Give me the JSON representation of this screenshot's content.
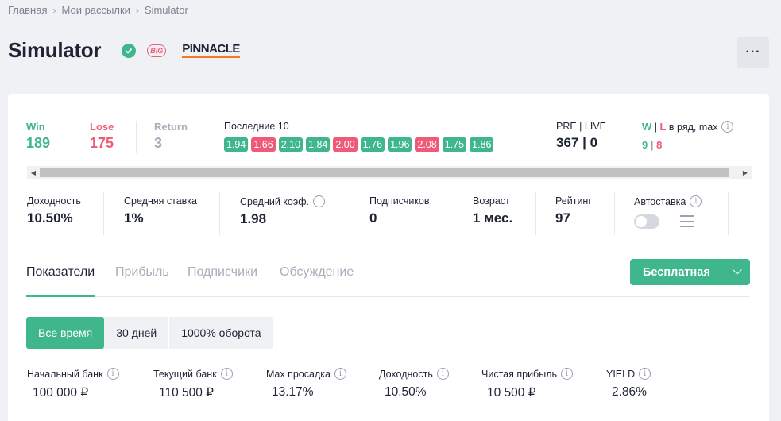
{
  "breadcrumb": {
    "items": [
      "Главная",
      "Мои рассылки",
      "Simulator"
    ]
  },
  "header": {
    "title": "Simulator",
    "badge_big": "BIG",
    "bookmaker": "PINNACLE",
    "more_label": "···"
  },
  "stats": {
    "win": {
      "label": "Win",
      "value": "189",
      "color": "#3fb68b"
    },
    "lose": {
      "label": "Lose",
      "value": "175",
      "color": "#ee5a78"
    },
    "return": {
      "label": "Return",
      "value": "3",
      "color": "#a9aeba"
    },
    "last10": {
      "label": "Последние 10",
      "chips": [
        {
          "value": "1.94",
          "result": "win"
        },
        {
          "value": "1.66",
          "result": "lose"
        },
        {
          "value": "2.10",
          "result": "win"
        },
        {
          "value": "1.84",
          "result": "win"
        },
        {
          "value": "2.00",
          "result": "lose"
        },
        {
          "value": "1.76",
          "result": "win"
        },
        {
          "value": "1.96",
          "result": "win"
        },
        {
          "value": "2.08",
          "result": "lose"
        },
        {
          "value": "1.75",
          "result": "win"
        },
        {
          "value": "1.86",
          "result": "win"
        }
      ]
    },
    "prelive": {
      "label": "PRE | LIVE",
      "value": "367 | 0"
    },
    "streak": {
      "label_w": "W",
      "label_sep": " | ",
      "label_l": "L",
      "label_rest": " в ряд, max",
      "value_w": "9",
      "value_sep": " | ",
      "value_l": "8"
    }
  },
  "metrics": {
    "yield": {
      "label": "Доходность",
      "value": "10.50%"
    },
    "avg_stake": {
      "label": "Средняя ставка",
      "value": "1%"
    },
    "avg_odds": {
      "label": "Средний коэф.",
      "value": "1.98"
    },
    "subscribers": {
      "label": "Подписчиков",
      "value": "0"
    },
    "age": {
      "label": "Возраст",
      "value": "1 мес."
    },
    "rating": {
      "label": "Рейтинг",
      "value": "97"
    },
    "autobet": {
      "label": "Автоставка"
    }
  },
  "tabs": [
    "Показатели",
    "Прибыль",
    "Подписчики",
    "Обсуждение"
  ],
  "plan_button": "Бесплатная",
  "periods": [
    "Все время",
    "30 дней",
    "1000% оборота"
  ],
  "bank": {
    "start": {
      "label": "Начальный банк",
      "value": "100 000 ₽"
    },
    "current": {
      "label": "Текущий банк",
      "value": "110 500 ₽"
    },
    "drawdown": {
      "label": "Max просадка",
      "value": "13.17%"
    },
    "yield": {
      "label": "Доходность",
      "value": "10.50%"
    },
    "profit": {
      "label": "Чистая прибыль",
      "value": "10 500 ₽"
    },
    "yield_pct": {
      "label": "YIELD",
      "value": "2.86%"
    }
  }
}
